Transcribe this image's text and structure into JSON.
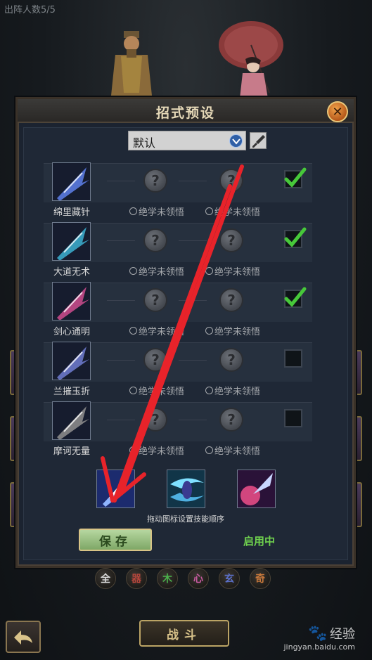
{
  "header": {
    "deploy_count": "出阵人数5/5"
  },
  "dialog": {
    "title": "招式预设",
    "close_icon": "close-icon",
    "preset": {
      "selected": "默认"
    },
    "skills": [
      {
        "name": "绵里藏针",
        "slot1": "绝学未领悟",
        "slot2": "绝学未领悟",
        "checked": true,
        "color": "#5a7be0"
      },
      {
        "name": "大道无术",
        "slot1": "绝学未领悟",
        "slot2": "绝学未领悟",
        "checked": true,
        "color": "#3aa9c9"
      },
      {
        "name": "剑心通明",
        "slot1": "绝学未领悟",
        "slot2": "绝学未领悟",
        "checked": true,
        "color": "#c44a8a"
      },
      {
        "name": "兰摧玉折",
        "slot1": "绝学未领悟",
        "slot2": "绝学未领悟",
        "checked": false,
        "color": "#6a78c9"
      },
      {
        "name": "摩诃无量",
        "slot1": "绝学未领悟",
        "slot2": "绝学未领悟",
        "checked": false,
        "color": "#8a8a8a"
      }
    ],
    "hint": "拖动图标设置技能顺序",
    "save_label": "保存",
    "status_label": "启用中"
  },
  "elements": [
    "全",
    "器",
    "木",
    "心",
    "玄",
    "奇"
  ],
  "bottom": {
    "fight_label": "战斗"
  },
  "watermark": {
    "brand": "经验",
    "site": "jingyan.baidu.com"
  },
  "annotation": {
    "arrow_color": "#e8232a"
  }
}
